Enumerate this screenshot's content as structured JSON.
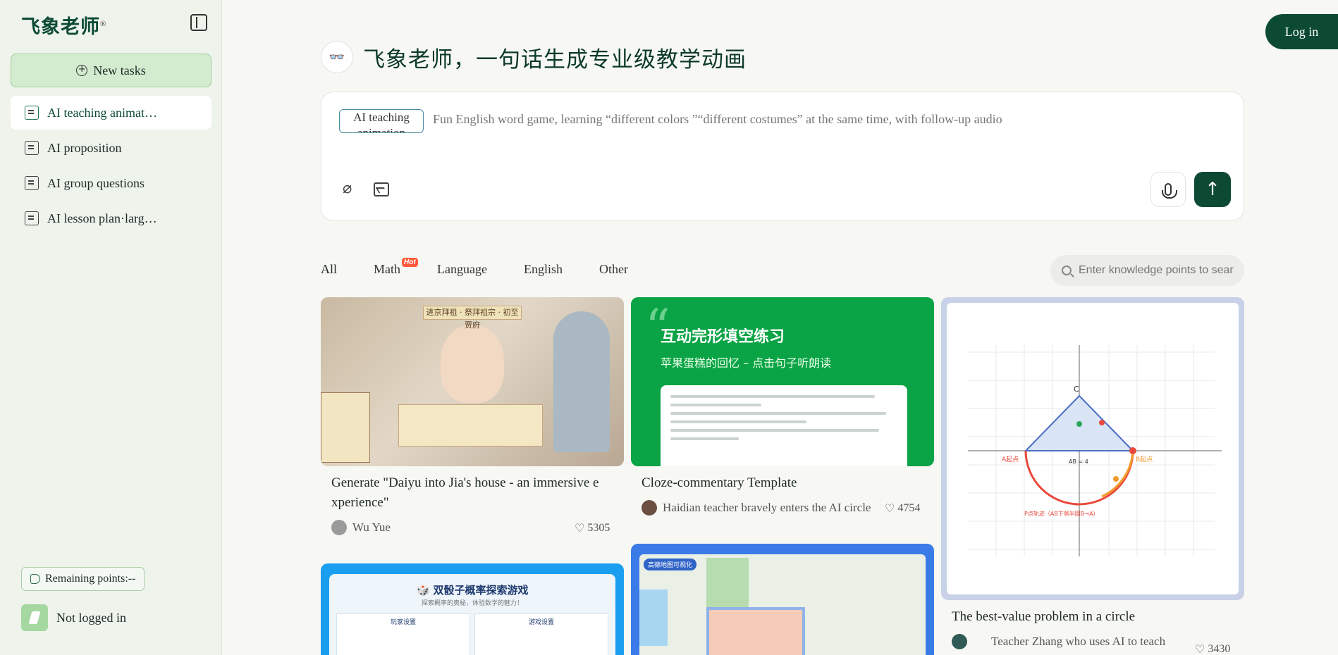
{
  "brand": {
    "logo_text": "飞象老师",
    "reg_mark": "®"
  },
  "sidebar": {
    "new_task_label": "New tasks",
    "items": [
      {
        "label": "AI teaching animat…",
        "icon": "video-icon",
        "active": true
      },
      {
        "label": "AI proposition",
        "icon": "list-icon"
      },
      {
        "label": "AI group questions",
        "icon": "group-icon"
      },
      {
        "label": "AI lesson plan·larg…",
        "icon": "book-icon"
      }
    ],
    "points_label": "Remaining points:--",
    "user_status": "Not logged in"
  },
  "header": {
    "login_label": "Log in"
  },
  "hero": {
    "logo_glyph": "👓",
    "title": "飞象老师，一句话生成专业级教学动画"
  },
  "prompt": {
    "mode_chip": "AI teaching animation",
    "placeholder": "Fun English word game, learning “different colors ”“different costumes” at the same time, with follow-up audio",
    "send_glyph": "↑"
  },
  "filters": {
    "tabs": [
      {
        "label": "All",
        "active": true
      },
      {
        "label": "Math",
        "badge": "Hot"
      },
      {
        "label": "Language"
      },
      {
        "label": "English"
      },
      {
        "label": "Other"
      }
    ],
    "search_placeholder": "Enter knowledge points to search"
  },
  "cards": [
    {
      "title": "Generate \"Daiyu into Jia's house - an immersive e xperience\"",
      "author": "Wu Yue",
      "likes": "5305",
      "thumb_text": {
        "banner": "进京拜祖 · 祭拜祖宗 · 初至贾府"
      }
    },
    {
      "title": "Cloze-commentary Template",
      "author": "Haidian teacher bravely enters the AI circle",
      "likes": "4754",
      "thumb_text": {
        "heading": "互动完形填空练习",
        "subheading": "苹果蛋糕的回忆 – 点击句子听朗读"
      }
    },
    {
      "title": "The best-value problem in a circle",
      "author": "Teacher Zhang who uses AI to teach",
      "likes": "3430",
      "thumb_text": {
        "label_c": "C",
        "label_ab": "AB = 4",
        "label_path": "P点轨迹（AB下侧半圆B→A）",
        "label_a": "A起点",
        "label_b": "B起点"
      }
    },
    {
      "thumb_text": {
        "heading": "🎲 双骰子概率探索游戏",
        "subheading": "探索概率的奥秘，体验数学的魅力！",
        "panel_left": "玩家设置",
        "panel_right": "游戏设置"
      }
    },
    {
      "thumb_text": {
        "chip": "高德地图可视化"
      }
    }
  ],
  "colors": {
    "brand": "#0c4a34",
    "accent_green": "#d3ebcf",
    "hot": "#ff5a3c"
  }
}
